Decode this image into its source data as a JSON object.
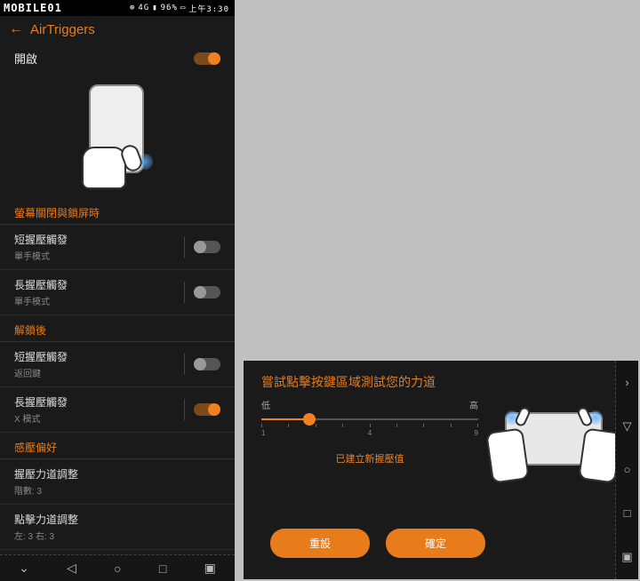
{
  "status_bar": {
    "logo": "MOBILE01",
    "network": "4G",
    "battery": "96%",
    "time": "上午3:30"
  },
  "header": {
    "title": "AirTriggers"
  },
  "main_toggle": {
    "label": "開啟",
    "on": true
  },
  "sections": {
    "screen_off_lock": "螢幕關閉與鎖屏時",
    "after_unlock": "解鎖後",
    "pressure_pref": "感壓偏好"
  },
  "settings": {
    "short_squeeze_1": {
      "title": "短握壓觸發",
      "sub": "單手模式",
      "on": false
    },
    "long_squeeze_1": {
      "title": "長握壓觸發",
      "sub": "單手模式",
      "on": false
    },
    "short_squeeze_2": {
      "title": "短握壓觸發",
      "sub": "返回鍵",
      "on": false
    },
    "long_squeeze_2": {
      "title": "長握壓觸發",
      "sub": "X 模式",
      "on": true
    },
    "squeeze_force": {
      "title": "握壓力道調整",
      "sub": "階數: 3"
    },
    "tap_force": {
      "title": "點擊力道調整",
      "sub": "左: 3 右: 3"
    }
  },
  "dialog": {
    "title": "嘗試點擊按鍵區域測試您的力道",
    "low": "低",
    "high": "高",
    "tick_min": "1",
    "tick_mid": "4",
    "tick_max": "9",
    "confirm": "已建立新握壓值",
    "reset": "重設",
    "ok": "確定"
  }
}
